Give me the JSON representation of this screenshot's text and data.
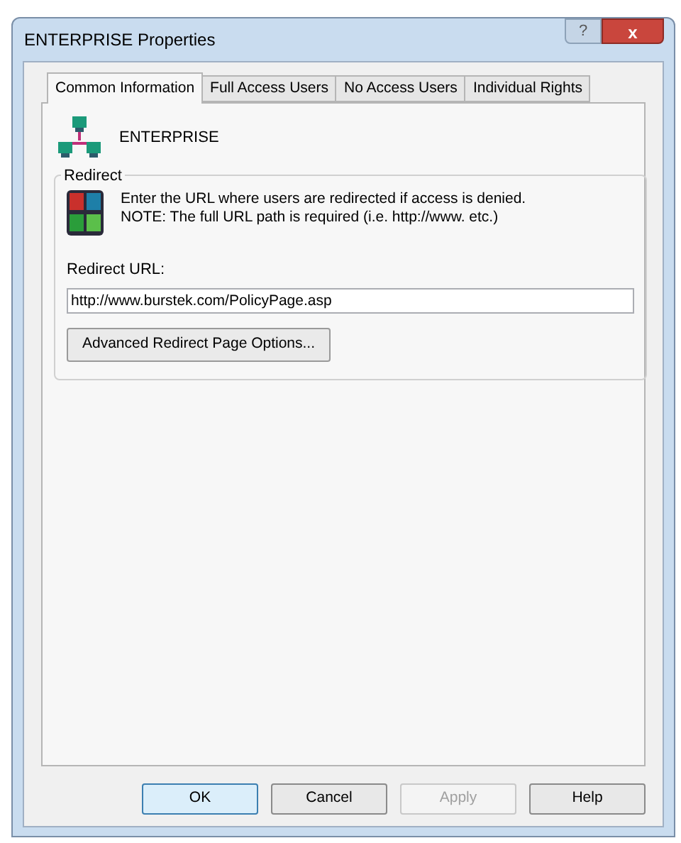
{
  "window": {
    "title": "ENTERPRISE Properties",
    "title_buttons": [
      "?",
      "x"
    ]
  },
  "tabs": [
    {
      "label": "Common Information",
      "selected": true
    },
    {
      "label": "Full Access Users",
      "selected": false
    },
    {
      "label": "No Access Users",
      "selected": false
    },
    {
      "label": "Individual Rights",
      "selected": false
    }
  ],
  "header": {
    "name": "ENTERPRISE"
  },
  "redirect_group": {
    "title": "Redirect",
    "description": "Enter the URL where users are redirected if access is denied.\nNOTE: The full URL path is required (i.e. http://www. etc.)",
    "url_label": "Redirect URL:",
    "url_value": "http://www.burstek.com/PolicyPage.asp",
    "options_button": "Advanced Redirect Page Options..."
  },
  "buttons": [
    {
      "label": "OK",
      "default": true,
      "disabled": false
    },
    {
      "label": "Cancel",
      "default": false,
      "disabled": false
    },
    {
      "label": "Apply",
      "default": false,
      "disabled": true
    },
    {
      "label": "Help",
      "default": false,
      "disabled": false
    }
  ]
}
